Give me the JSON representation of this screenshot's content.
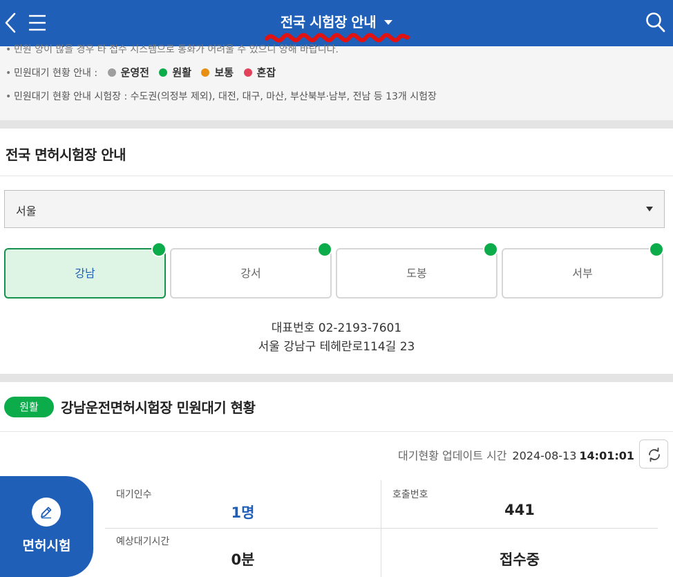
{
  "header": {
    "title": "전국 시험장 안내"
  },
  "notice": {
    "line1": "민원 양이 많을 경우 타 접수 시스템으로 통화가 어려울 수 있으니 양해 바랍니다.",
    "line2_label": "민원대기 현황 안내 :",
    "legend": [
      {
        "label": "운영전",
        "color": "#9e9e9e"
      },
      {
        "label": "원활",
        "color": "#0cac4a"
      },
      {
        "label": "보통",
        "color": "#e88f13"
      },
      {
        "label": "혼잡",
        "color": "#e2435a"
      }
    ],
    "line3": "민원대기 현황 안내 시험장 : 수도권(의정부 제외), 대전, 대구, 마산, 부산북부·남부, 전남 등 13개 시험장"
  },
  "centers_section": {
    "title": "전국 면허시험장 안내",
    "region_selected": "서울",
    "centers": [
      {
        "label": "강남",
        "active": true,
        "status_color": "#0cac4a"
      },
      {
        "label": "강서",
        "active": false,
        "status_color": "#0cac4a"
      },
      {
        "label": "도봉",
        "active": false,
        "status_color": "#0cac4a"
      },
      {
        "label": "서부",
        "active": false,
        "status_color": "#0cac4a"
      }
    ],
    "phone": "대표번호 02-2193-7601",
    "address": "서울 강남구 테헤란로114길 23"
  },
  "status": {
    "badge": "원활",
    "title": "강남운전면허시험장 민원대기 현황",
    "update_label": "대기현황 업데이트 시간",
    "update_date": "2024-08-13",
    "update_time": "14:01:01",
    "tab_label": "면허시험",
    "waiting_label": "대기인수",
    "waiting_value": "1명",
    "call_label": "호출번호",
    "call_value": "441",
    "expected_label": "예상대기시간",
    "expected_value": "0분",
    "state_value": "접수중"
  },
  "colors": {
    "primary": "#1f5fb8",
    "green": "#0cac4a"
  }
}
